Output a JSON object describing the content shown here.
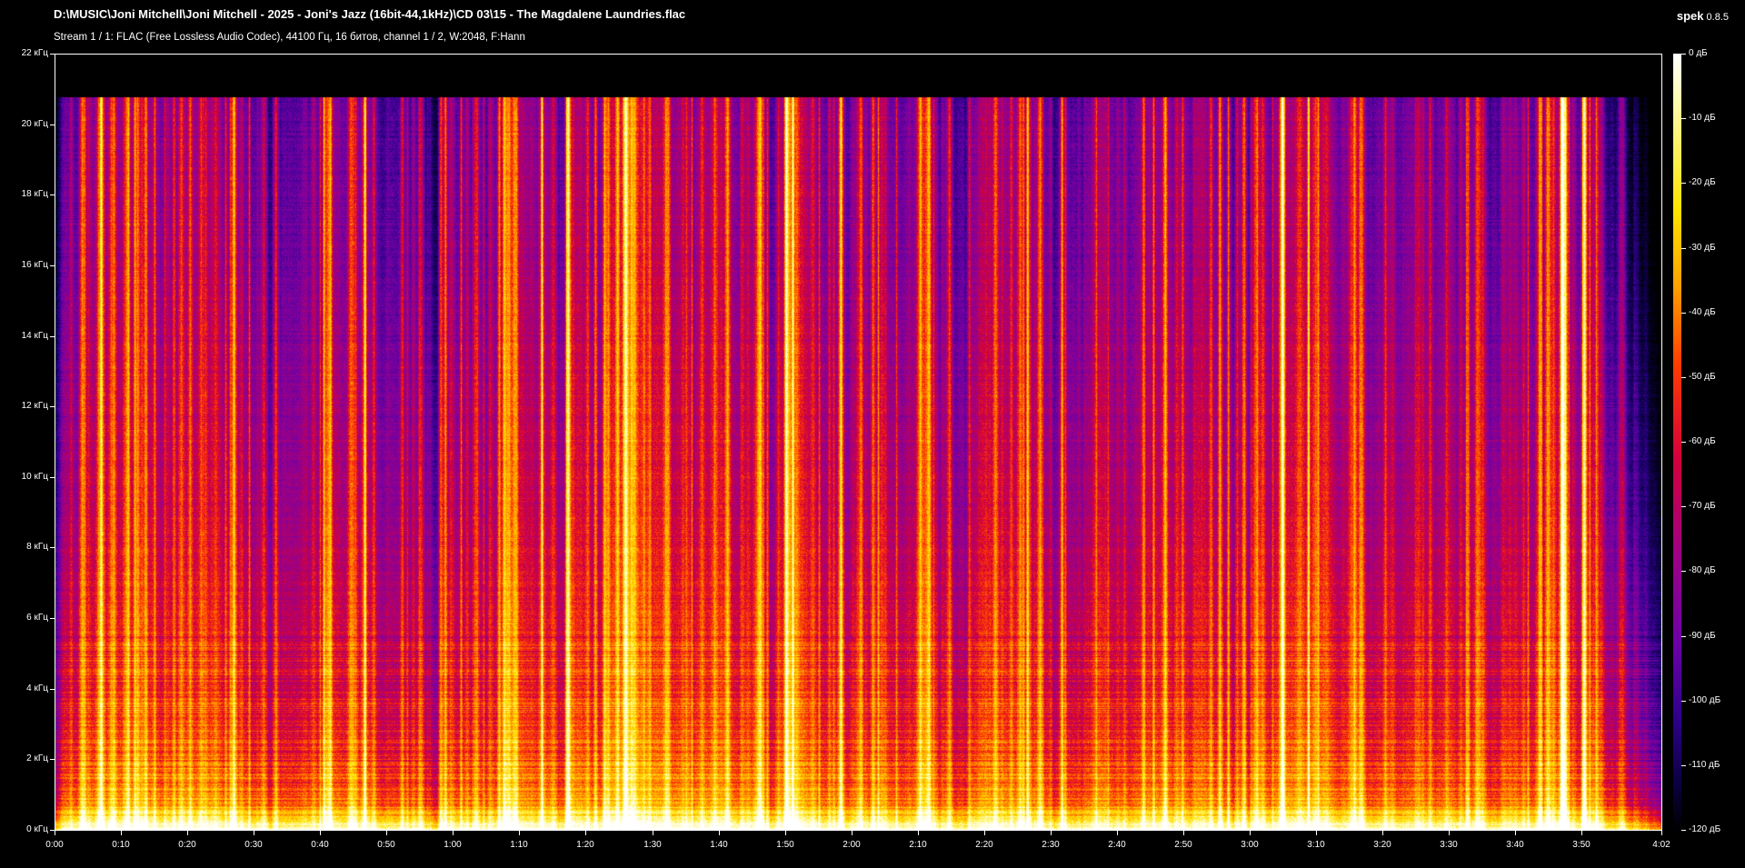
{
  "window": {
    "title": "D:\\MUSIC\\Joni Mitchell\\Joni Mitchell - 2025 - Joni's Jazz (16bit-44,1kHz)\\CD 03\\15 - The Magdalene Laundries.flac",
    "stream_info": "Stream 1 / 1: FLAC (Free Lossless Audio Codec), 44100 Гц, 16 битов, channel 1 / 2, W:2048, F:Hann",
    "app_name": "spek",
    "app_version": "0.8.5"
  },
  "frequency_axis": {
    "labels": [
      "0 кГц",
      "2 кГц",
      "4 кГц",
      "6 кГц",
      "8 кГц",
      "10 кГц",
      "12 кГц",
      "14 кГц",
      "16 кГц",
      "18 кГц",
      "20 кГц",
      "22 кГц"
    ],
    "min_khz": 0,
    "max_khz": 22
  },
  "time_axis": {
    "labels": [
      "0:00",
      "0:10",
      "0:20",
      "0:30",
      "0:40",
      "0:50",
      "1:00",
      "1:10",
      "1:20",
      "1:30",
      "1:40",
      "1:50",
      "2:00",
      "2:10",
      "2:20",
      "2:30",
      "2:40",
      "2:50",
      "3:00",
      "3:10",
      "3:20",
      "3:30",
      "3:40",
      "3:50",
      "4:02"
    ],
    "duration_seconds": 242
  },
  "level_scale": {
    "labels": [
      "0 дБ",
      "-10 дБ",
      "-20 дБ",
      "-30 дБ",
      "-40 дБ",
      "-50 дБ",
      "-60 дБ",
      "-70 дБ",
      "-80 дБ",
      "-90 дБ",
      "-100 дБ",
      "-110 дБ",
      "-120 дБ"
    ],
    "max_db": 0,
    "min_db": -120
  },
  "colors": {
    "background": "#000000",
    "text": "#ffffff",
    "palette": [
      "#000000",
      "#0b0040",
      "#2c0088",
      "#6c00a8",
      "#a00083",
      "#d4003a",
      "#ff3c00",
      "#ffa000",
      "#ffe400",
      "#fffbb0",
      "#ffffff"
    ]
  }
}
